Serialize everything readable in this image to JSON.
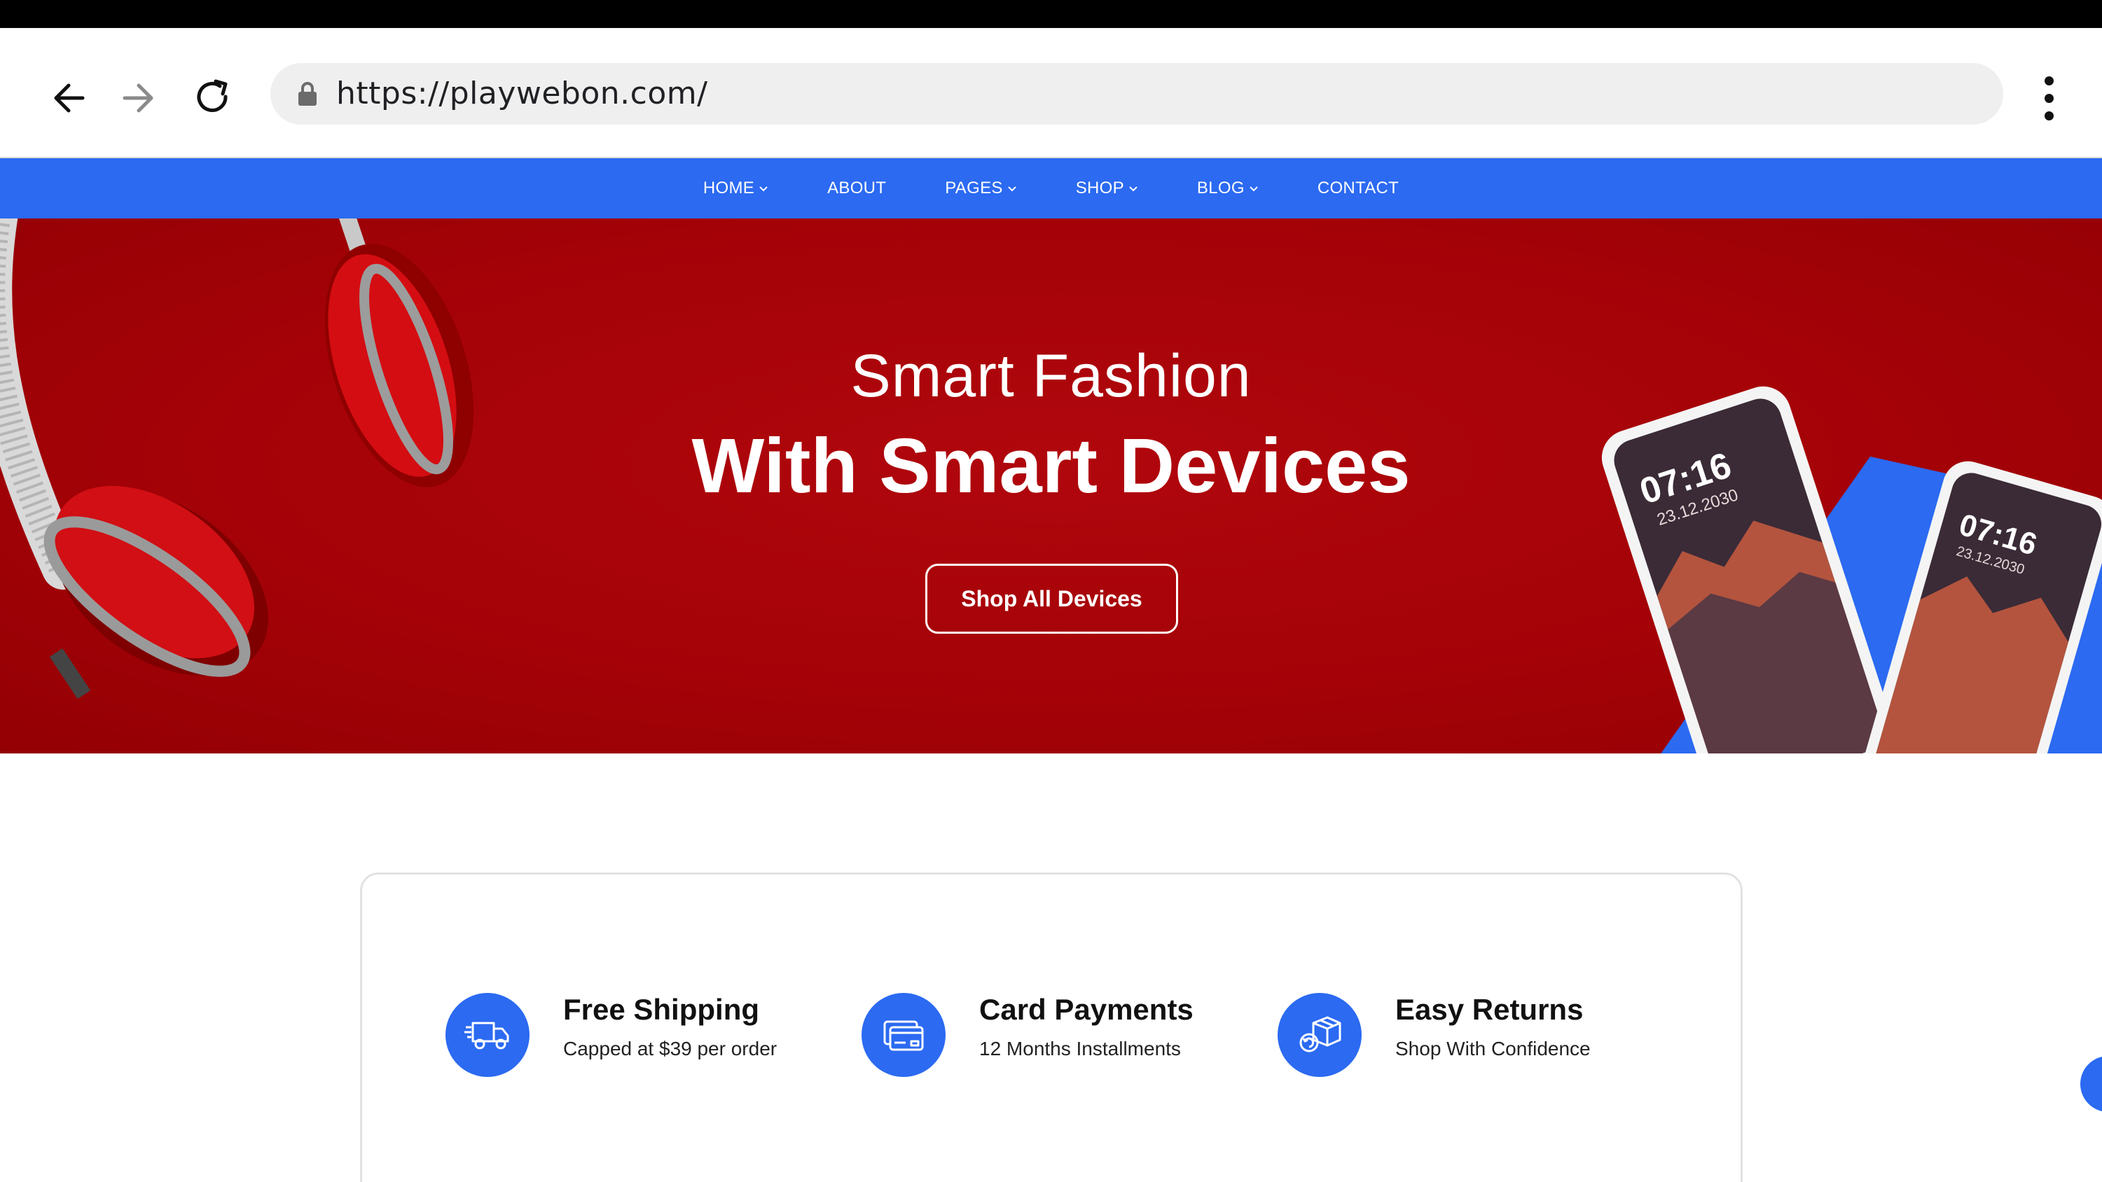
{
  "browser": {
    "url": "https://playwebon.com/",
    "back_icon": "arrow-left-icon",
    "forward_icon": "arrow-right-icon",
    "reload_icon": "reload-icon",
    "lock_icon": "lock-icon",
    "menu_icon": "kebab-menu-icon"
  },
  "site_nav": {
    "items": [
      {
        "label": "HOME",
        "has_dropdown": true
      },
      {
        "label": "ABOUT",
        "has_dropdown": false
      },
      {
        "label": "PAGES",
        "has_dropdown": true
      },
      {
        "label": "SHOP",
        "has_dropdown": true
      },
      {
        "label": "BLOG",
        "has_dropdown": true
      },
      {
        "label": "CONTACT",
        "has_dropdown": false
      }
    ]
  },
  "hero": {
    "subtitle": "Smart Fashion",
    "title": "With Smart Devices",
    "cta_label": "Shop All Devices",
    "phone_time_1": "07:16",
    "phone_date_1": "23.12.2030",
    "phone_time_2": "07:16",
    "phone_date_2": "23.12.2030"
  },
  "features": [
    {
      "icon": "truck-icon",
      "title": "Free Shipping",
      "desc": "Capped at $39 per order"
    },
    {
      "icon": "credit-card-icon",
      "title": "Card Payments",
      "desc": "12 Months Installments"
    },
    {
      "icon": "return-box-icon",
      "title": "Easy Returns",
      "desc": "Shop With Confidence"
    }
  ],
  "colors": {
    "nav_blue": "#2b6af1",
    "hero_red": "#a30207",
    "text_dark": "#111111"
  }
}
